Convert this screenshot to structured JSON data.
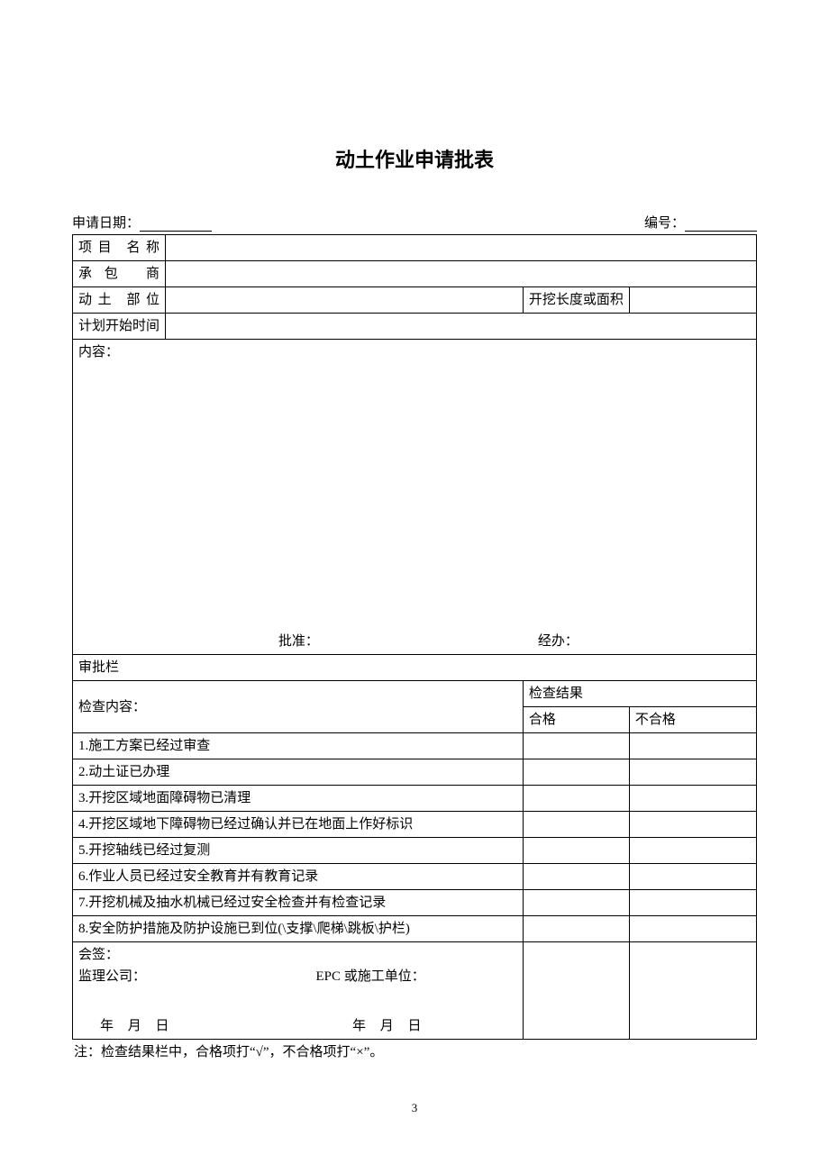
{
  "title": "动土作业申请批表",
  "header": {
    "apply_date_label": "申请日期：",
    "serial_label": "编号："
  },
  "rows": {
    "project_name_label": "项目 名称",
    "contractor_label": "承包 商",
    "location_label": "动土 部位",
    "dig_length_label": "开挖长度或面积",
    "plan_start_label": "计划开始时间",
    "content_label": "内容：",
    "approve_label": "批准：",
    "handle_label": "经办：",
    "approval_col_label": "审批栏",
    "inspect_content_label": "检查内容：",
    "inspect_result_label": "检查结果",
    "pass_label": "合格",
    "fail_label": "不合格"
  },
  "checklist": [
    "1.施工方案已经过审查",
    "2.动土证已办理",
    "3.开挖区域地面障碍物已清理",
    "4.开挖区域地下障碍物已经过确认并已在地面上作好标识",
    "5.开挖轴线已经过复测",
    "6.作业人员已经过安全教育并有教育记录",
    "7.开挖机械及抽水机械已经过安全检查并有检查记录",
    "8.安全防护措施及防护设施已到位(\\支撑\\爬梯\\跳板\\护栏)"
  ],
  "sign": {
    "cosign_label": "会签：",
    "supervisor_label": "监理公司：",
    "epc_label": "EPC 或施工单位：",
    "date_text": "年 月 日"
  },
  "note": "注：检查结果栏中，合格项打“√”，不合格项打“×”。",
  "page_number": "3"
}
